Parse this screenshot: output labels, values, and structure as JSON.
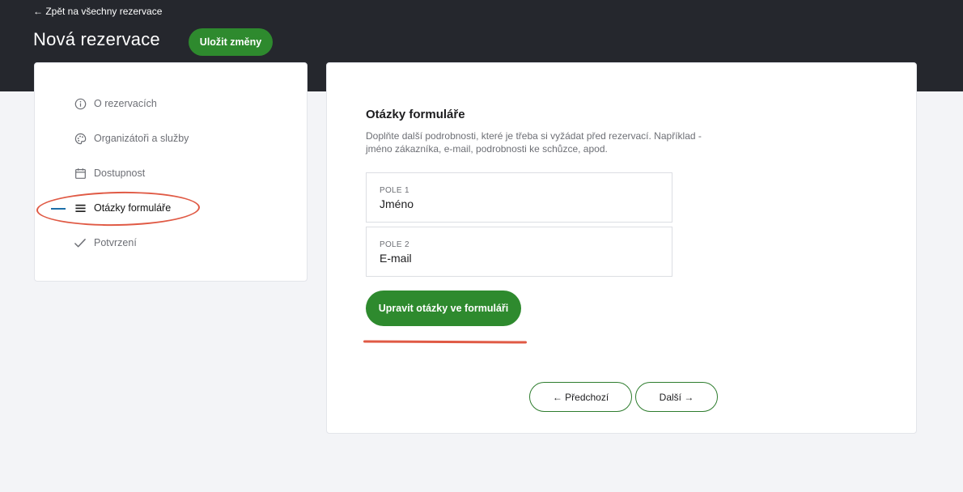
{
  "header": {
    "back_link": "← Zpět na všechny rezervace",
    "title": "Nová rezervace",
    "save_label": "Uložit změny"
  },
  "sidebar": {
    "items": [
      {
        "label": "O rezervacích",
        "icon": "info-icon"
      },
      {
        "label": "Organizátoři a služby",
        "icon": "palette-icon"
      },
      {
        "label": "Dostupnost",
        "icon": "calendar-icon"
      },
      {
        "label": "Otázky formuláře",
        "icon": "list-icon",
        "active": true
      },
      {
        "label": "Potvrzení",
        "icon": "check-icon"
      }
    ]
  },
  "main": {
    "title": "Otázky formuláře",
    "description": "Doplňte další podrobnosti, které je třeba si vyžádat před rezervací. Například - jméno zákazníka, e-mail, podrobnosti ke schůzce, apod.",
    "fields": [
      {
        "label": "POLE 1",
        "value": "Jméno"
      },
      {
        "label": "POLE 2",
        "value": "E-mail"
      }
    ],
    "edit_button": "Upravit otázky ve formuláři",
    "prev_button": "← Předchozí",
    "next_button": "Další →"
  },
  "colors": {
    "accent": "#2e8a2e",
    "header_bg": "#25272d",
    "annotation": "#e05a45",
    "active_marker": "#1c6fa8"
  }
}
